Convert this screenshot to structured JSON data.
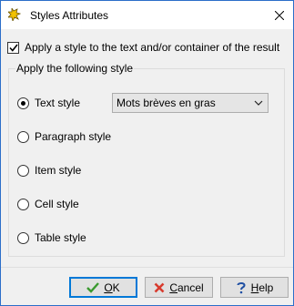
{
  "window": {
    "title": "Styles Attributes",
    "app_icon": "styles-icon",
    "close_icon": "close-icon"
  },
  "apply_checkbox": {
    "label": "Apply a style to the text and/or container of the result",
    "checked": true
  },
  "style_group": {
    "legend": "Apply the following style",
    "options": [
      {
        "label": "Text style",
        "selected": true
      },
      {
        "label": "Paragraph style",
        "selected": false
      },
      {
        "label": "Item style",
        "selected": false
      },
      {
        "label": "Cell style",
        "selected": false
      },
      {
        "label": "Table style",
        "selected": false
      }
    ],
    "text_style_select": {
      "value": "Mots brèves en gras"
    }
  },
  "buttons": {
    "ok": {
      "label_underlined": "O",
      "label_rest": "K",
      "icon": "checkmark-icon"
    },
    "cancel": {
      "label_underlined": "C",
      "label_rest": "ancel",
      "icon": "x-icon"
    },
    "help": {
      "label_underlined": "H",
      "label_rest": "elp",
      "icon": "help-icon"
    }
  },
  "colors": {
    "accent": "#0078d7",
    "ok_check": "#3a9a2f",
    "cancel_x": "#d83b2e",
    "app_icon": "#f2c200"
  }
}
